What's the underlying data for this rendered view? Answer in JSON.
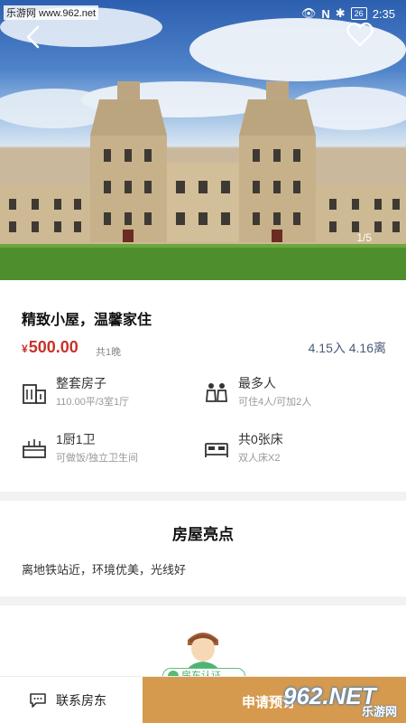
{
  "watermark_top": "乐游网 www.962.net",
  "status": {
    "battery": "26",
    "time": "2:35"
  },
  "gallery": {
    "page_indicator": "1/5"
  },
  "listing": {
    "title": "精致小屋，温馨家住",
    "currency": "¥",
    "price": "500.00",
    "nights": "共1晚",
    "dates": "4.15入 4.16离"
  },
  "features": [
    {
      "icon": "building-icon",
      "label": "整套房子",
      "sub": "110.00平/3室1厅"
    },
    {
      "icon": "people-icon",
      "label": "最多人",
      "sub": "可住4人/可加2人"
    },
    {
      "icon": "kitchen-icon",
      "label": "1厨1卫",
      "sub": "可做饭/独立卫生间"
    },
    {
      "icon": "bed-icon",
      "label": "共0张床",
      "sub": "双人床X2"
    }
  ],
  "highlights": {
    "title": "房屋亮点",
    "text": "离地铁站近，环境优美，光线好"
  },
  "host": {
    "verify_label": "房东认证"
  },
  "bottom_bar": {
    "contact_label": "联系房东",
    "apply_label": "申请预订"
  },
  "watermark_bottom": {
    "number": "962.NET",
    "text": "乐游网"
  },
  "colors": {
    "price": "#c8312a",
    "apply_button": "#d69a4e",
    "verify": "#58bb74",
    "dates": "#4a5a7a"
  }
}
